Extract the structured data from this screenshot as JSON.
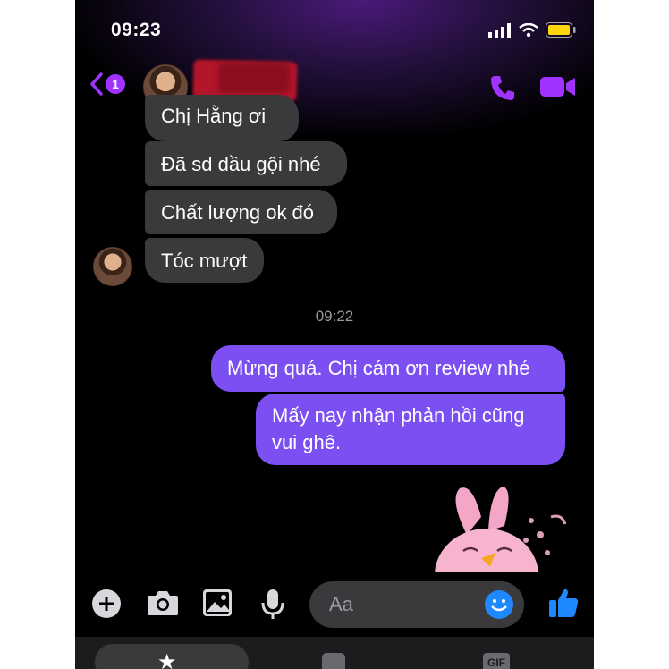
{
  "status_bar": {
    "time": "09:23"
  },
  "header": {
    "unread_count": "1"
  },
  "messages": {
    "incoming": [
      "Chị Hằng ơi",
      "Đã sd dầu gội nhé",
      "Chất lượng ok đó",
      "Tóc mượt"
    ],
    "timestamp": "09:22",
    "outgoing": [
      "Mừng quá. Chị cám ơn review nhé",
      "Mấy nay nhận phản hồi cũng vui ghê."
    ]
  },
  "composer": {
    "placeholder": "Aa"
  },
  "tray": {
    "gif_label": "GIF"
  },
  "colors": {
    "accent": "#a033ff",
    "outgoing_bubble": "#7b4ff2",
    "incoming_bubble": "#3a3a3c"
  }
}
